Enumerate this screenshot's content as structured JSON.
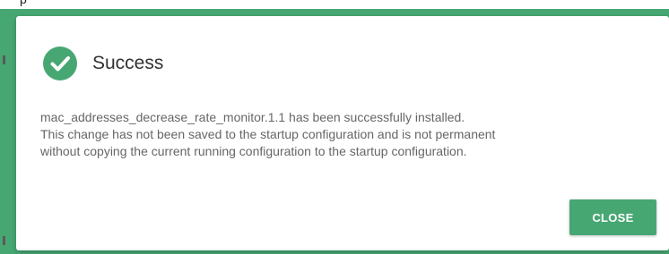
{
  "background": {
    "partial_text": "p"
  },
  "dialog": {
    "title": "Success",
    "icon": "check-circle-icon",
    "message_lines": [
      "mac_addresses_decrease_rate_monitor.1.1 has been successfully installed.",
      "This change has not been saved to the startup configuration and is not permanent",
      "without copying the current running configuration to the startup configuration."
    ],
    "close_label": "CLOSE"
  },
  "colors": {
    "accent": "#47a773",
    "title_text": "#333333",
    "body_text": "#666666"
  }
}
